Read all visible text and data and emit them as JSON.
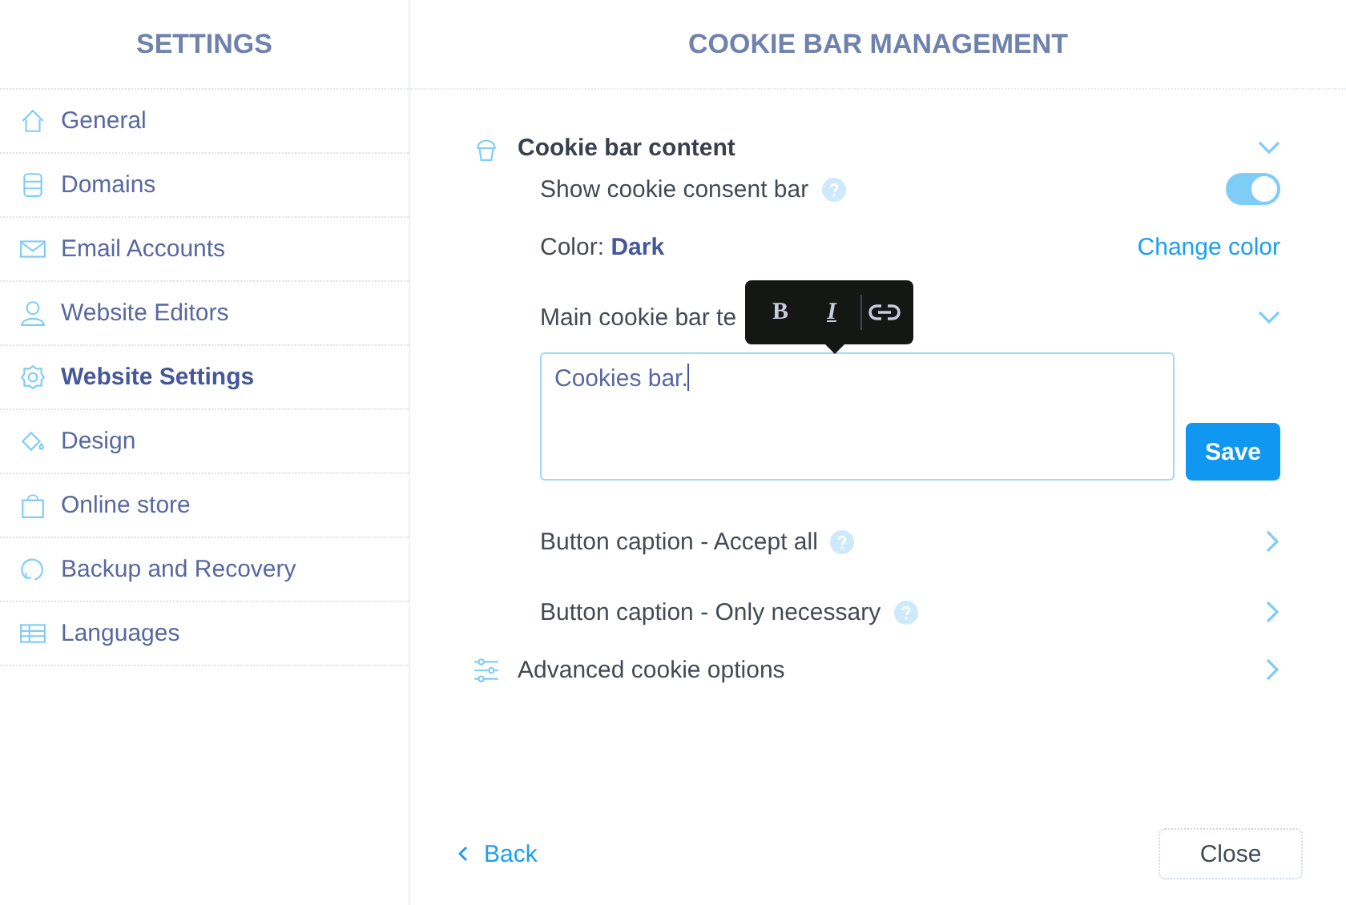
{
  "sidebar": {
    "title": "SETTINGS",
    "items": [
      {
        "label": "General",
        "selected": false
      },
      {
        "label": "Domains",
        "selected": false
      },
      {
        "label": "Email Accounts",
        "selected": false
      },
      {
        "label": "Website Editors",
        "selected": false
      },
      {
        "label": "Website Settings",
        "selected": true
      },
      {
        "label": "Design",
        "selected": false
      },
      {
        "label": "Online store",
        "selected": false
      },
      {
        "label": "Backup and Recovery",
        "selected": false
      },
      {
        "label": "Languages",
        "selected": false
      }
    ]
  },
  "main": {
    "title": "COOKIE BAR MANAGEMENT",
    "sections": [
      {
        "title": "Cookie bar content",
        "expanded": true,
        "rows": [
          {
            "kind": "toggle",
            "label": "Show cookie consent bar",
            "help": true,
            "on": true
          },
          {
            "kind": "color",
            "label": "Color:",
            "value": "Dark",
            "action": "Change color"
          },
          {
            "kind": "editor",
            "label": "Main cookie bar te",
            "expanded": true,
            "value": "Cookies bar.",
            "button": "Save",
            "format_buttons": [
              "B",
              "I"
            ]
          },
          {
            "kind": "link",
            "label": "Button caption - Accept all",
            "help": true
          },
          {
            "kind": "link",
            "label": "Button caption - Only necessary",
            "help": true
          }
        ]
      },
      {
        "title": "Advanced cookie options",
        "expanded": false
      }
    ]
  },
  "footer": {
    "back": "Back",
    "close": "Close"
  }
}
